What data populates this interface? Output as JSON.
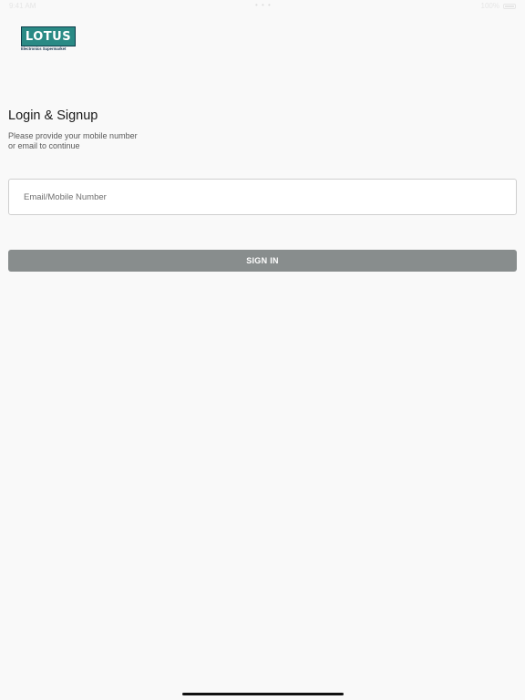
{
  "status_bar": {
    "time": "9:41 AM",
    "dots": "• • •",
    "battery_percent": "100%"
  },
  "logo": {
    "text": "LOTUS",
    "tagline": "Electronics Supermarket",
    "colors": {
      "fill": "#2a8a85",
      "border": "#0d3d4a"
    }
  },
  "login": {
    "title": "Login & Signup",
    "subtitle": "Please provide your mobile number\n or email to continue",
    "input_placeholder": "Email/Mobile Number",
    "input_value": "",
    "sign_in_label": "SIGN IN"
  },
  "colors": {
    "background": "#f9f9f9",
    "button": "#888d8d",
    "button_text": "#ffffff"
  }
}
